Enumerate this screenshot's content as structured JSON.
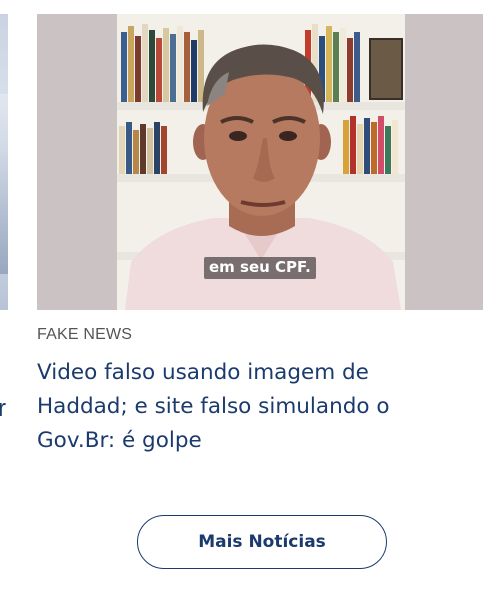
{
  "previous_card": {
    "title_fragment": "r"
  },
  "card": {
    "video_subtitle": "em seu CPF.",
    "category": "FAKE NEWS",
    "headline": "Video falso usando imagem de Haddad; e site falso simulando o Gov.Br: é golpe"
  },
  "more_button": {
    "label": "Mais Notícias"
  },
  "colors": {
    "headline": "#1b3a6d",
    "category": "#555555",
    "button_border": "#1b3a6d"
  }
}
